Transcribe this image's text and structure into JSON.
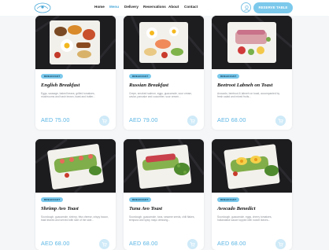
{
  "nav": {
    "links": [
      "Home",
      "Menu",
      "Delivery",
      "Reservations",
      "About",
      "Contact"
    ],
    "active": "Menu",
    "reserve_label": "RESERVE TABLE",
    "icon": "person-icon"
  },
  "colors": {
    "accent": "#7cc9ec",
    "price": "#5bb6e4",
    "badge_text": "#0d3b57"
  },
  "dishes": [
    {
      "category": "BREAKFAST",
      "name": "English Breakfast",
      "description": "Eggs, sausage, baked beans, grilled tomatoes, mushrooms and hash brown, toast and butter...",
      "price": "AED 75.00"
    },
    {
      "category": "BREAKFAST",
      "name": "Russian Breakfast",
      "description": "Crepe, smoked salmon, eggs, guacamole, sour cream, caviar, pancake and cucumber, sour cream...",
      "price": "AED 79.00"
    },
    {
      "category": "BREAKFAST",
      "name": "Beetroot Labneh on Toast",
      "description": "Avocado, beetroot & labneh on toast, accompanied by fresh salad and mixed fruits...",
      "price": "AED 68.00"
    },
    {
      "category": "BREAKFAST",
      "name": "Shrimp Avo Toast",
      "description": "Sourdough, guacamole, shrimp, feta cheese, crispy bacon, basil leaves and served with side of the side...",
      "price": "AED 68.00"
    },
    {
      "category": "BREAKFAST",
      "name": "Tuna Avo Toast",
      "description": "Sourdough, guacamole, tuna, sesame seeds, chili flakes, tempura and spicy mayo dressing...",
      "price": "AED 68.00"
    },
    {
      "category": "BREAKFAST",
      "name": "Avocado Benedict",
      "description": "Sourdough, guacamole, eggs, cherry tomatoes, hollandaise sauce topped with rocket leaves...",
      "price": "AED 68.00"
    }
  ]
}
